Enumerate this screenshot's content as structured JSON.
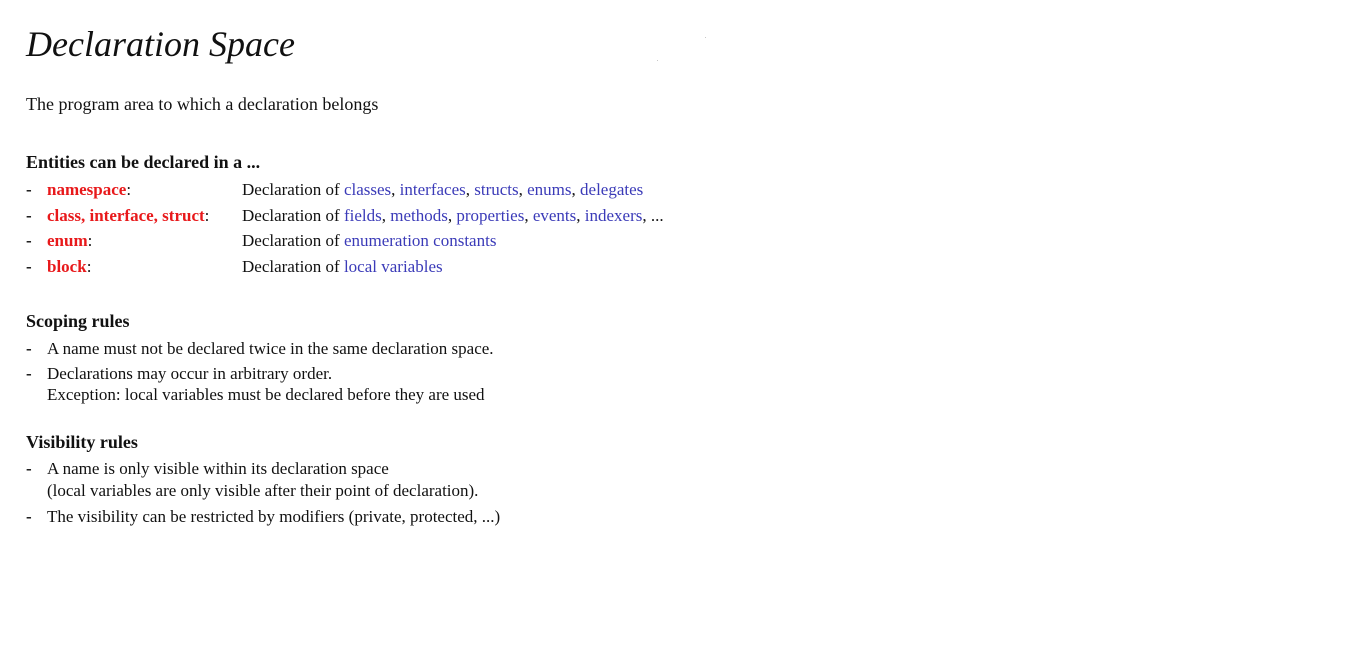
{
  "title": "Declaration Space",
  "subtitle": "The program area to which a declaration belongs",
  "entities": {
    "heading": "Entities can be declared in a ...",
    "rows": [
      {
        "keyword": "namespace",
        "colon": ":",
        "prefix": "Declaration of ",
        "items": [
          "classes",
          "interfaces",
          "structs",
          "enums",
          "delegates"
        ],
        "suffix": ""
      },
      {
        "keyword": "class, interface, struct",
        "colon": ":",
        "prefix": "Declaration of ",
        "items": [
          "fields",
          "methods",
          "properties",
          "events",
          "indexers"
        ],
        "suffix": ", ..."
      },
      {
        "keyword": "enum",
        "colon": ":",
        "prefix": "Declaration of ",
        "items": [
          "enumeration constants"
        ],
        "suffix": ""
      },
      {
        "keyword": "block",
        "colon": ":",
        "prefix": "Declaration of ",
        "items": [
          "local variables"
        ],
        "suffix": ""
      }
    ]
  },
  "scoping": {
    "heading": "Scoping rules",
    "items": [
      {
        "line1": "A name must not be declared twice in the same declaration space.",
        "line2": ""
      },
      {
        "line1": "Declarations may occur in arbitrary order.",
        "line2": "Exception: local variables must be declared before they are used"
      }
    ]
  },
  "visibility": {
    "heading": "Visibility rules",
    "items": [
      {
        "line1": "A name is only visible within its declaration space",
        "line2": "(local variables are only visible after their point of declaration)."
      },
      {
        "line1": "The visibility can be restricted by modifiers (private, protected, ...)",
        "line2": ""
      }
    ]
  },
  "bullet": "-",
  "colors": {
    "keyword": "#e8191b",
    "link": "#3b3bb8",
    "text": "#111111"
  }
}
